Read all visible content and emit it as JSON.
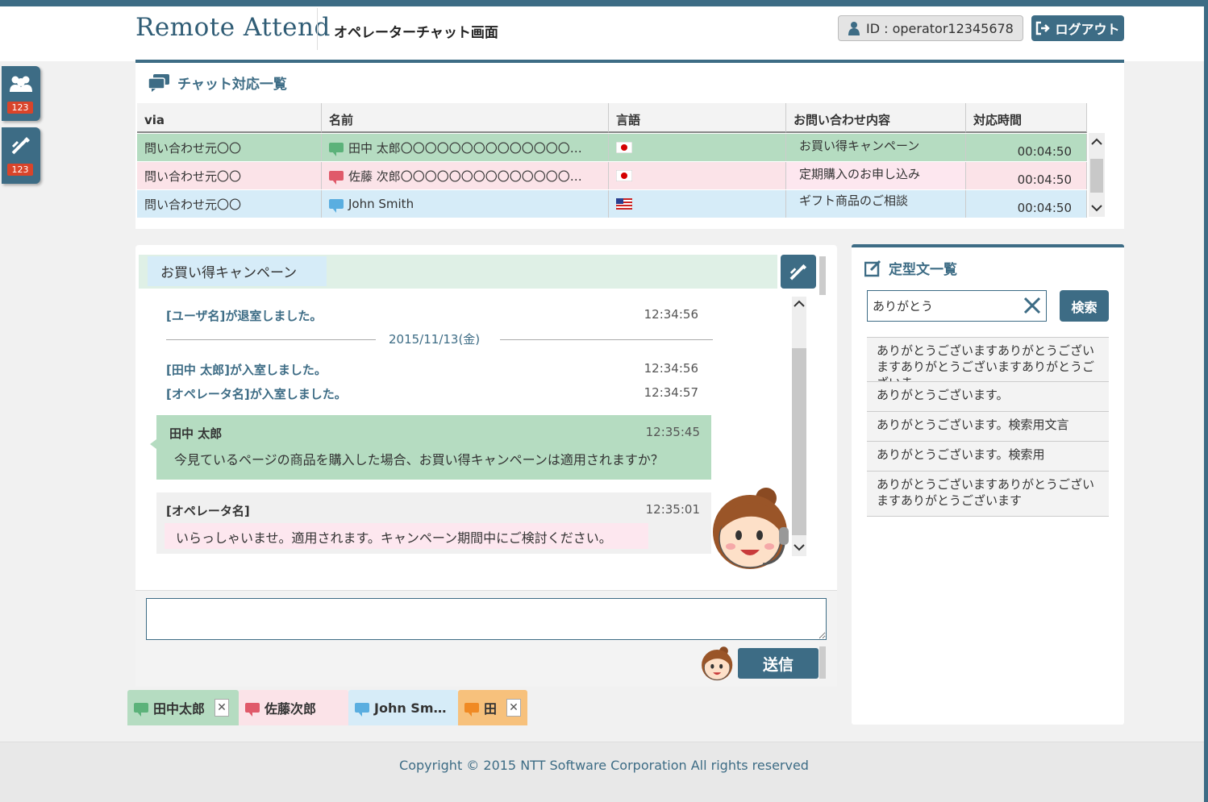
{
  "header": {
    "logo": "Remote Attend",
    "title": "オペレーターチャット画面",
    "user_id": "ID : operator12345678",
    "logout": "ログアウト"
  },
  "sidebar": {
    "users_badge": "123",
    "chat_badge": "123"
  },
  "chat_list": {
    "title": "チャット対応一覧",
    "columns": [
      "via",
      "名前",
      "言語",
      "お問い合わせ内容",
      "対応時間"
    ],
    "rows": [
      {
        "via": "問い合わせ元〇〇",
        "name": "田中 太郎〇〇〇〇〇〇〇〇〇〇〇〇〇〇…",
        "lang": "ja",
        "inquiry": "お買い得キャンペーン",
        "time": "00:04:50",
        "color": "#5cb27a"
      },
      {
        "via": "問い合わせ元〇〇",
        "name": "佐藤 次郎〇〇〇〇〇〇〇〇〇〇〇〇〇〇…",
        "lang": "ja",
        "inquiry": "定期購入のお申し込み",
        "time": "00:04:50",
        "color": "#e05a6a"
      },
      {
        "via": "問い合わせ元〇〇",
        "name": "John Smith",
        "lang": "en",
        "inquiry": "ギフト商品のご相談",
        "time": "00:04:50",
        "color": "#5aaee0"
      }
    ]
  },
  "chat": {
    "subject": "お買い得キャンペーン",
    "sys1": {
      "text": "[ユーザ名]が退室しました。",
      "time": "12:34:56"
    },
    "date": "2015/11/13(金)",
    "sys2": {
      "text": "[田中 太郎]が入室しました。",
      "time": "12:34:56"
    },
    "sys3": {
      "text": "[オペレータ名]が入室しました。",
      "time": "12:34:57"
    },
    "msg1": {
      "sender": "田中 太郎",
      "time": "12:35:45",
      "text": "今見ているページの商品を購入した場合、お買い得キャンペーンは適用されますか？"
    },
    "msg2": {
      "sender": "[オペレータ名]",
      "time": "12:35:01",
      "text": "いらっしゃいませ。適用されます。キャンペーン期間中にご検討ください。"
    },
    "send": "送信"
  },
  "phrases": {
    "title": "定型文一覧",
    "search_value": "ありがとう",
    "search_button": "検索",
    "items": [
      "ありがとうございますありがとうございますありがとうございますありがとうございま…",
      "ありがとうございます。",
      "ありがとうございます。検索用文言",
      "ありがとうございます。検索用",
      "ありがとうございますありがとうございますありがとうございます"
    ]
  },
  "tabs": [
    {
      "label": "田中太郎",
      "bg": "#b5dcc1",
      "icon": "#5cb27a"
    },
    {
      "label": "佐藤次郎",
      "bg": "#fbe3e8",
      "icon": "#e05a6a"
    },
    {
      "label": "John Sm…",
      "bg": "#d6ecf8",
      "icon": "#5aaee0"
    },
    {
      "label": "田",
      "bg": "#f7c17c",
      "icon": "#f08a24"
    }
  ],
  "footer": {
    "copyright": "Copyright © 2015 NTT Software Corporation All rights reserved"
  }
}
